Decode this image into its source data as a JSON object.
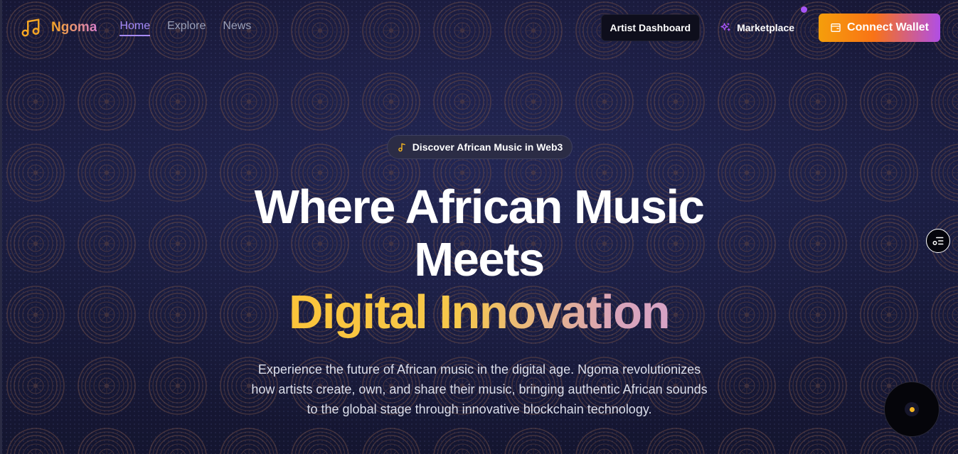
{
  "brand": {
    "name": "Ngoma",
    "icon": "music-note-icon"
  },
  "nav": {
    "links": [
      {
        "label": "Home",
        "active": true
      },
      {
        "label": "Explore",
        "active": false
      },
      {
        "label": "News",
        "active": false
      }
    ],
    "artist_dashboard": "Artist Dashboard",
    "marketplace": "Marketplace",
    "connect_wallet": "Connect Wallet"
  },
  "hero": {
    "badge": "Discover African Music in Web3",
    "headline_line1": "Where African Music",
    "headline_line2": "Meets",
    "headline_accent": "Digital Innovation",
    "subtitle": "Experience the future of African music in the digital age. Ngoma revolutionizes how artists create, own, and share their music, bringing authentic African sounds to the global stage through innovative blockchain technology."
  },
  "colors": {
    "background": "#12132b",
    "accent_orange": "#f5a524",
    "accent_purple": "#a855f7",
    "accent_yellow": "#fbc43a",
    "nav_active": "#a78bfa"
  }
}
